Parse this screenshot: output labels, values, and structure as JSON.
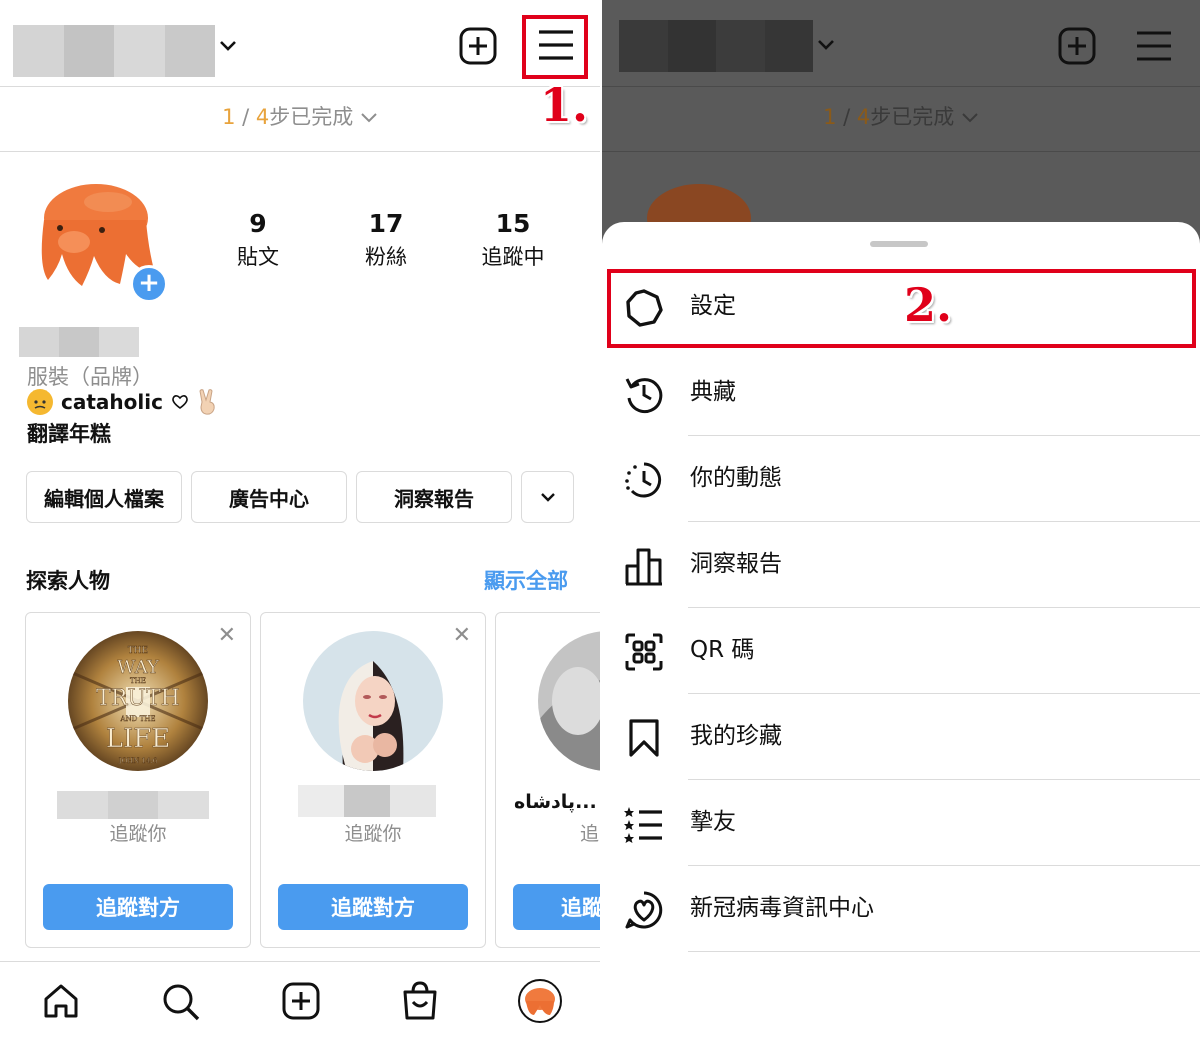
{
  "left": {
    "progress": {
      "done": "1",
      "sep": " / ",
      "total": "4",
      "label": "步已完成"
    },
    "stats": [
      {
        "num": "9",
        "label": "貼文"
      },
      {
        "num": "17",
        "label": "粉絲"
      },
      {
        "num": "15",
        "label": "追蹤中"
      }
    ],
    "bio": {
      "category": "服裝（品牌）",
      "line1_text": "cataholic",
      "line2": "翻譯年糕"
    },
    "buttons": {
      "edit": "編輯個人檔案",
      "ads": "廣告中心",
      "insights": "洞察報告"
    },
    "discover": {
      "title": "探索人物",
      "see_all": "顯示全部"
    },
    "cards": [
      {
        "sub": "追蹤你",
        "button": "追蹤對方",
        "close": "✕"
      },
      {
        "sub": "追蹤你",
        "button": "追蹤對方",
        "close": "✕"
      },
      {
        "name": "پادشاه...",
        "sub": "追",
        "button": "追蹤"
      }
    ],
    "book_title_lines": [
      "THE",
      "WAY",
      "THE",
      "TRUTH",
      "AND THE",
      "LIFE",
      "JOHN 14:6"
    ]
  },
  "right": {
    "progress": {
      "done": "1",
      "sep": " / ",
      "total": "4",
      "label": "步已完成"
    },
    "menu": [
      {
        "label": "設定",
        "icon": "settings-gear-icon"
      },
      {
        "label": "典藏",
        "icon": "archive-history-icon"
      },
      {
        "label": "你的動態",
        "icon": "activity-clock-icon"
      },
      {
        "label": "洞察報告",
        "icon": "insights-bar-chart-icon"
      },
      {
        "label": "QR 碼",
        "icon": "qr-code-icon"
      },
      {
        "label": "我的珍藏",
        "icon": "bookmark-icon"
      },
      {
        "label": "摯友",
        "icon": "close-friends-list-icon"
      },
      {
        "label": "新冠病毒資訊中心",
        "icon": "covid-info-heart-icon"
      }
    ]
  },
  "annotations": {
    "step1": "1.",
    "step2": "2."
  },
  "colors": {
    "accent_blue": "#4a9bef",
    "progress_orange": "#e8a33c",
    "annotation_red": "#e0001a",
    "overlay_dark": "#5a5a5a"
  }
}
